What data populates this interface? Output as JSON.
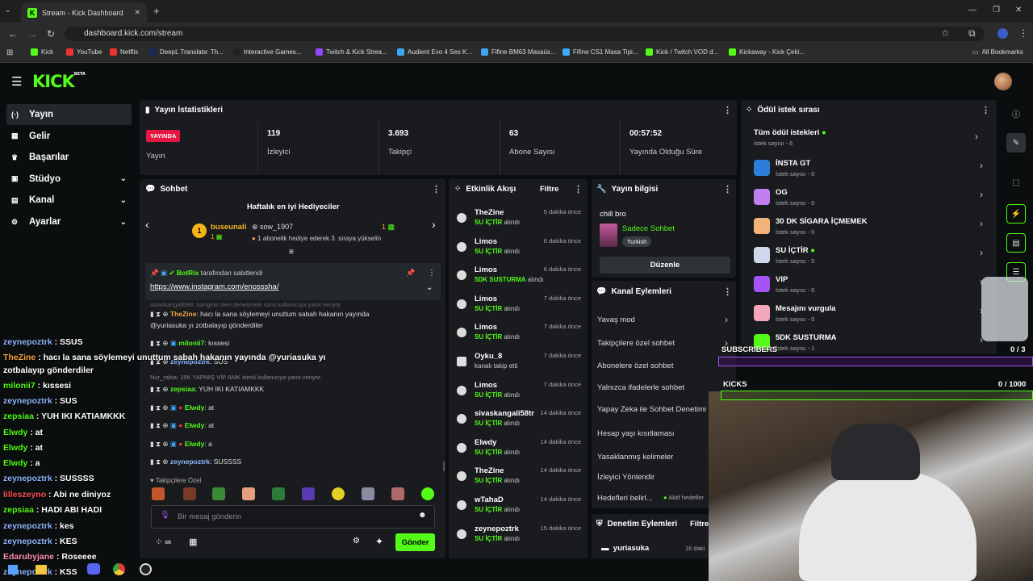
{
  "browser": {
    "tab_title": "Stream - Kick Dashboard",
    "url": "dashboard.kick.com/stream",
    "all_bookmarks": "All Bookmarks",
    "bookmarks": [
      "Kick",
      "YouTube",
      "Netflix",
      "DeepL Translate: Th...",
      "Interactive Games...",
      "Twitch & Kick Strea...",
      "Audient Evo 4 Ses K...",
      "Fifine BM63 Masaüs...",
      "Fifine CS1 Masa Tipi...",
      "Kick / Twitch VOD d...",
      "Kickaway - Kick Çeki..."
    ]
  },
  "brand": {
    "logo": "KICK",
    "beta": "BETA"
  },
  "nav": [
    {
      "label": "Yayın",
      "icon": "broadcast-icon"
    },
    {
      "label": "Gelir",
      "icon": "revenue-icon"
    },
    {
      "label": "Başarılar",
      "icon": "trophy-icon"
    },
    {
      "label": "Stüdyo",
      "icon": "studio-icon"
    },
    {
      "label": "Kanal",
      "icon": "channel-icon"
    },
    {
      "label": "Ayarlar",
      "icon": "gear-icon"
    }
  ],
  "stats": {
    "title": "Yayın İstatistikleri",
    "live_badge": "YAYINDA",
    "live_label": "Yayın",
    "items": [
      {
        "value": "119",
        "label": "İzleyici"
      },
      {
        "value": "3.693",
        "label": "Takipçi"
      },
      {
        "value": "63",
        "label": "Abone Sayısı"
      },
      {
        "value": "00:57:52",
        "label": "Yayında Olduğu Süre"
      }
    ]
  },
  "chat": {
    "title": "Sohbet",
    "gifters_title": "Haftalık en iyi Hediyeciler",
    "gifter1": "buseunali",
    "gifter1_count": "1",
    "gifter2": "sow_1907",
    "gifter2_count": "1",
    "gifter_msg": "1 abonelik hediye ederek 3. sıraya yükselin",
    "pinned_by": "BotRix",
    "pinned_suffix": "tarafından sabitlendi",
    "pinned_link": "https://www.instagram.com/enosssha/",
    "reply1": "sivaskangali58tr: kanginin ben denetimeki isimi kullanıcıya yanıt veriyor",
    "msg1_user": "TheZine",
    "msg1_text": ": hacı la sana söylemeyi unuttum sabah hakanın yayında",
    "msg1_text2": "@yuriasuka yı zotbalayıp gönderdiler",
    "msg2_user": "milonii7",
    "msg2_text": ": kıssesi",
    "msg3_user": "zeynepoztrk",
    "msg3_text": ": SUS",
    "reply2": "Nur_rabia: 15K YAPMIŞ VİP AMK isimli kullanıcıya yanıt veriyor",
    "msg4_user": "zepsiaa",
    "msg4_text": ": YUH IKI KATIAMKKK",
    "msg5_user": "Elwdy",
    "msg5_text": ": at",
    "msg6_user": "Elwdy",
    "msg6_text": ": at",
    "msg7_user": "Elwdy",
    "msg7_text": ": a",
    "msg8_user": "zeynepoztrk",
    "msg8_text": ": SUSSSS",
    "followers_only": "Takipçilere Özel",
    "input_placeholder": "Bir mesaj gönderin",
    "send": "Gönder",
    "points": "∞"
  },
  "activity": {
    "title": "Etkinlik Akışı",
    "filter": "Filtre",
    "items": [
      {
        "name": "TheZine",
        "action": "SU İÇTİR",
        "suffix": "alındı",
        "time": "5 dakika önce"
      },
      {
        "name": "Limos",
        "action": "SU İÇTİR",
        "suffix": "alındı",
        "time": "6 dakika önce"
      },
      {
        "name": "Limos",
        "action": "5DK SUSTURMA",
        "suffix": "alındı",
        "time": "6 dakika önce"
      },
      {
        "name": "Limos",
        "action": "SU İÇTİR",
        "suffix": "alındı",
        "time": "7 dakika önce"
      },
      {
        "name": "Limos",
        "action": "SU İÇTİR",
        "suffix": "alındı",
        "time": "7 dakika önce"
      },
      {
        "name": "Oyku_8",
        "action": "",
        "suffix": "kanalı takip etti",
        "time": "7 dakika önce"
      },
      {
        "name": "Limos",
        "action": "SU İÇTİR",
        "suffix": "alındı",
        "time": "7 dakika önce"
      },
      {
        "name": "sivaskangali58tr",
        "action": "SU İÇTİR",
        "suffix": "alındı",
        "time": "14 dakika önce"
      },
      {
        "name": "Elwdy",
        "action": "SU İÇTİR",
        "suffix": "alındı",
        "time": "14 dakika önce"
      },
      {
        "name": "TheZine",
        "action": "SU İÇTİR",
        "suffix": "alındı",
        "time": "14 dakika önce"
      },
      {
        "name": "wTahaD",
        "action": "SU İÇTİR",
        "suffix": "alındı",
        "time": "14 dakika önce"
      },
      {
        "name": "zeynepoztrk",
        "action": "SU İÇTİR",
        "suffix": "alındı",
        "time": "15 dakika önce"
      }
    ]
  },
  "streaminfo": {
    "title": "Yayın bilgisi",
    "stream_title": "chill bro",
    "category": "Sadece Sohbet",
    "language": "Turkish",
    "edit": "Düzenle"
  },
  "channel_actions": {
    "title": "Kanal Eylemleri",
    "items": [
      "Yavaş mod",
      "Takipçilere özel sohbet",
      "Abonelere özel sohbet",
      "Yalnızca ifadelerle sohbet",
      "Yapay Zeka ile Sohbet Denetimi",
      "Hesap yaşı kısıtlaması",
      "Yasaklanmış kelimeler",
      "İzleyici Yönlendir",
      "Hedefleri belirl..."
    ],
    "goal_status": "Aktif hedefler"
  },
  "mod_actions": {
    "title": "Denetim Eylemleri",
    "filter": "Filtre",
    "user": "yuriasuka",
    "time": "16 daki"
  },
  "rewards": {
    "title": "Ödül istek sırası",
    "all": "Tüm ödül istekleri",
    "all_count": "İstek sayısı - 6",
    "items": [
      {
        "name": "İNSTA GT",
        "count": "İstek sayısı - 0",
        "color": "#2b7fd9"
      },
      {
        "name": "OG",
        "count": "İstek sayısı - 0",
        "color": "#c07ef0"
      },
      {
        "name": "30 DK SİGARA İÇMEMEK",
        "count": "İstek sayısı - 0",
        "color": "#f2b27a"
      },
      {
        "name": "SU İÇTİR",
        "count": "İstek sayısı - 5",
        "color": "#cfd8ea"
      },
      {
        "name": "VIP",
        "count": "İstek sayısı - 0",
        "color": "#a454f5"
      },
      {
        "name": "Mesajını vurgula",
        "count": "İstek sayısı - 0",
        "color": "#f2a6b9"
      },
      {
        "name": "5DK SUSTURMA",
        "count": "İstek sayısı - 1",
        "color": "#53fc18"
      }
    ]
  },
  "overlay": {
    "subscribers": "SUBSCRIBERS",
    "sub_count": "0 / 3",
    "kicks": "KICKS",
    "kick_count": "0 / 1000",
    "chat": [
      {
        "user": "zeynepoztrk",
        "text": " : SSUS",
        "color": "#8fb6ff"
      },
      {
        "user": "TheZine",
        "text": " : hacı la sana söylemeyi unuttum sabah hakanın yayında @yuriasuka yı",
        "color": "#f5a340"
      },
      {
        "user": "",
        "text": "zotbalayıp gönderdiler",
        "color": "#fff"
      },
      {
        "user": "milonii7",
        "text": " : kıssesi",
        "color": "#53fc18"
      },
      {
        "user": "zeynepoztrk",
        "text": " : SUS",
        "color": "#8fb6ff"
      },
      {
        "user": "zepsiaa",
        "text": " : YUH IKI KATIAMKKK",
        "color": "#53fc18"
      },
      {
        "user": "Elwdy",
        "text": " : at",
        "color": "#53fc18"
      },
      {
        "user": "Elwdy",
        "text": " : at",
        "color": "#53fc18"
      },
      {
        "user": "Elwdy",
        "text": " : a",
        "color": "#53fc18"
      },
      {
        "user": "zeynepoztrk",
        "text": " : SUSSSS",
        "color": "#8fb6ff"
      },
      {
        "user": "lilleszeyno",
        "text": " : Abi ne diniyoz",
        "color": "#ff4d4d"
      },
      {
        "user": "zepsiaa",
        "text": " : HADI ABI HADI",
        "color": "#53fc18"
      },
      {
        "user": "zeynepoztrk",
        "text": " : kes",
        "color": "#8fb6ff"
      },
      {
        "user": "zeynepoztrk",
        "text": " : KES",
        "color": "#8fb6ff"
      },
      {
        "user": "Edarubyjane",
        "text": " : Roseeee",
        "color": "#ff8fb6"
      },
      {
        "user": "zeynepoztrk",
        "text": " : KSS",
        "color": "#8fb6ff"
      }
    ]
  }
}
